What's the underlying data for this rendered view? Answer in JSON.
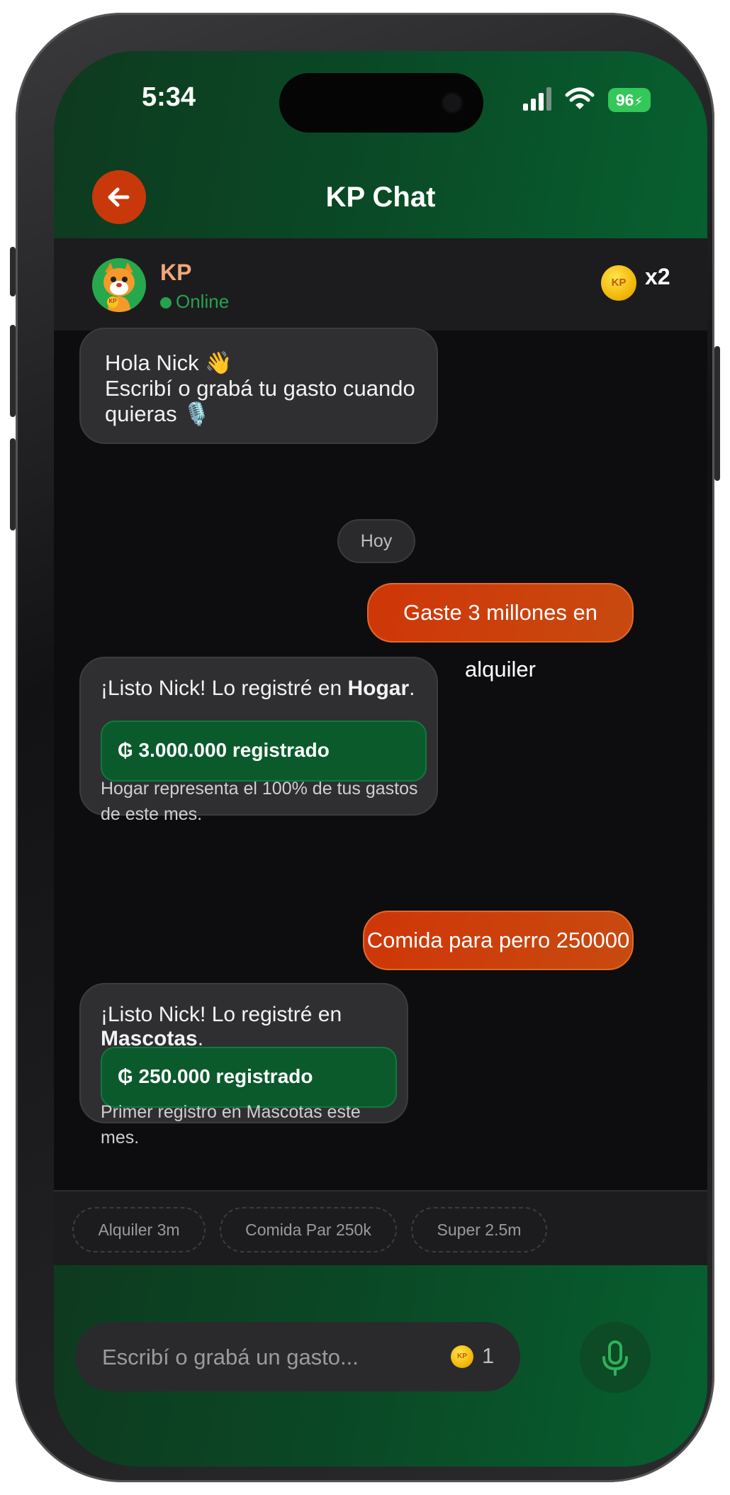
{
  "status_bar": {
    "time": "5:34",
    "battery": "96"
  },
  "header": {
    "title": "KP Chat",
    "back_icon": "arrow-left-icon"
  },
  "contact": {
    "name": "KP",
    "status": "Online",
    "avatar_badge": "KP",
    "coin_label": "KP",
    "multiplier": "x2"
  },
  "messages": [
    {
      "from": "bot",
      "lines": [
        "Hola Nick 👋",
        "Escribí o grabá tu gasto cuando",
        "quieras 🎙️"
      ]
    },
    {
      "from": "system",
      "text": "Hoy"
    },
    {
      "from": "user",
      "text": "Gaste 3 millones en alquiler"
    },
    {
      "from": "bot",
      "prefix": "¡Listo Nick! Lo registré en ",
      "category": "Hogar",
      "suffix": ".",
      "amount": "₲ 3.000.000 registrado",
      "note": "Hogar representa el 100% de tus gastos de este mes."
    },
    {
      "from": "user",
      "text": "Comida para perro 250000"
    },
    {
      "from": "bot",
      "prefix": "¡Listo Nick! Lo registré en ",
      "category": "Mascotas",
      "suffix": ".",
      "amount": "₲ 250.000 registrado",
      "note": "Primer registro en Mascotas este mes."
    }
  ],
  "quick_replies": [
    "Alquiler 3m",
    "Comida Par 250k",
    "Super 2.5m"
  ],
  "composer": {
    "placeholder": "Escribí o grabá un gasto...",
    "coin_label": "KP",
    "coin_cost": "1",
    "mic_icon": "microphone-icon"
  },
  "colors": {
    "brand_green": "#0a4a26",
    "accent_orange": "#cf3608",
    "bubble_dark": "#2f2f32",
    "online_green": "#26a24f"
  }
}
